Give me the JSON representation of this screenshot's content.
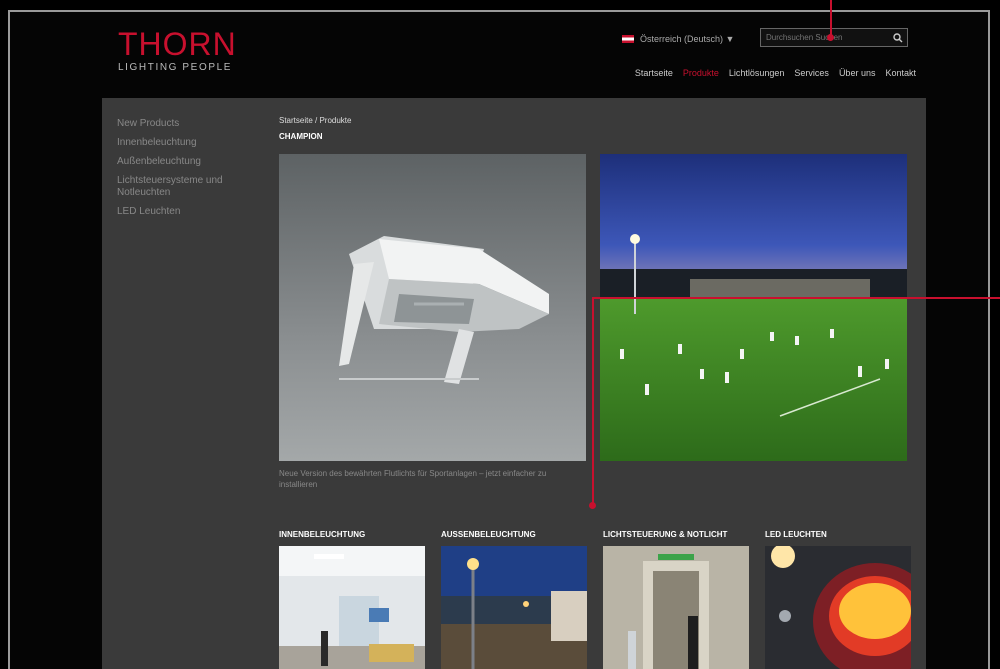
{
  "brand": {
    "name": "THORN",
    "tagline": "LIGHTING PEOPLE"
  },
  "header": {
    "language": "Österreich (Deutsch) ▼",
    "search_placeholder": "Durchsuchen Suchen"
  },
  "nav": [
    {
      "label": "Startseite",
      "active": false
    },
    {
      "label": "Produkte",
      "active": true
    },
    {
      "label": "Lichtlösungen",
      "active": false
    },
    {
      "label": "Services",
      "active": false
    },
    {
      "label": "Über uns",
      "active": false
    },
    {
      "label": "Kontakt",
      "active": false
    }
  ],
  "sidebar": [
    {
      "label": "New Products"
    },
    {
      "label": "Innenbeleuchtung"
    },
    {
      "label": "Außenbeleuchtung"
    },
    {
      "label": "Lichtsteuersysteme und Notleuchten"
    },
    {
      "label": "LED Leuchten"
    }
  ],
  "main": {
    "breadcrumb": "Startseite / Produkte",
    "title": "CHAMPION",
    "caption": "Neue Version des bewährten Flutlichts für Sportanlagen – jetzt einfacher zu installieren"
  },
  "categories": [
    {
      "label": "INNENBELEUCHTUNG"
    },
    {
      "label": "AUSSENBELEUCHTUNG"
    },
    {
      "label": "LICHTSTEUERUNG & NOTLICHT"
    },
    {
      "label": "LED LEUCHTEN"
    }
  ],
  "colors": {
    "accent": "#c8102e",
    "panel": "#3a3a3a",
    "background": "#050505"
  }
}
